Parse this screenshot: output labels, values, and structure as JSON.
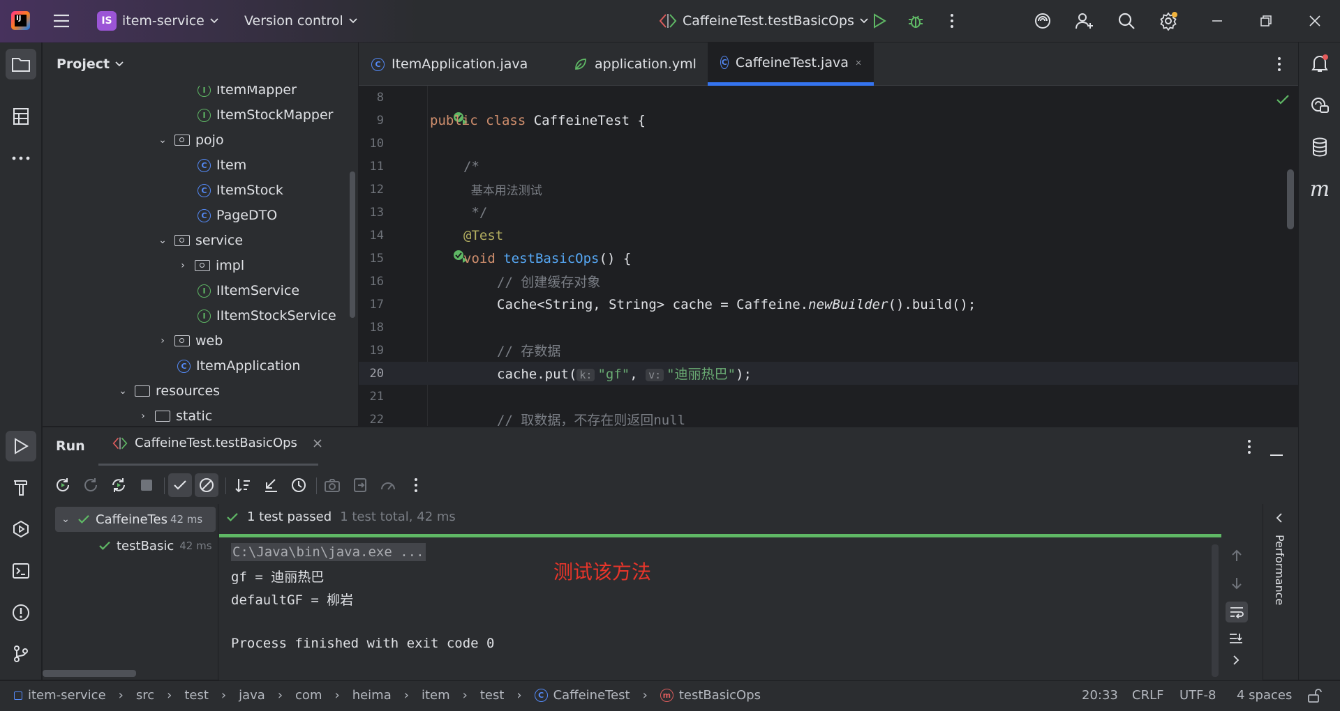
{
  "titlebar": {
    "project_badge": "IS",
    "project_name": "item-service",
    "vcs_label": "Version control",
    "run_config": "CaffeineTest.testBasicOps"
  },
  "project_panel": {
    "title": "Project",
    "tree": [
      {
        "label": "ItemMapper",
        "kind": "interface"
      },
      {
        "label": "ItemStockMapper",
        "kind": "interface"
      },
      {
        "label": "pojo",
        "kind": "package"
      },
      {
        "label": "Item",
        "kind": "class"
      },
      {
        "label": "ItemStock",
        "kind": "class"
      },
      {
        "label": "PageDTO",
        "kind": "class"
      },
      {
        "label": "service",
        "kind": "package"
      },
      {
        "label": "impl",
        "kind": "package"
      },
      {
        "label": "IItemService",
        "kind": "interface"
      },
      {
        "label": "IItemStockService",
        "kind": "interface"
      },
      {
        "label": "web",
        "kind": "package"
      },
      {
        "label": "ItemApplication",
        "kind": "class"
      },
      {
        "label": "resources",
        "kind": "folder"
      },
      {
        "label": "static",
        "kind": "folder"
      }
    ]
  },
  "editor": {
    "tabs": [
      {
        "label": "ItemApplication.java"
      },
      {
        "label": "application.yml"
      },
      {
        "label": "CaffeineTest.java"
      }
    ],
    "line_numbers": [
      "8",
      "9",
      "10",
      "11",
      "12",
      "13",
      "14",
      "15",
      "16",
      "17",
      "18",
      "19",
      "20",
      "21",
      "22"
    ],
    "code": {
      "l9_kw1": "public",
      "l9_kw2": "class",
      "l9_rest": " CaffeineTest {",
      "l11": "/*",
      "l12": "  基本用法测试",
      "l13": " */",
      "l14": "@Test",
      "l15_kw": "void",
      "l15_fn": "testBasicOps",
      "l15_rest": "() {",
      "l16": "// 创建缓存对象",
      "l17_a": "Cache<String, String> cache = Caffeine.",
      "l17_b": "newBuilder",
      "l17_c": "().build();",
      "l19": "// 存数据",
      "l20_a": "cache.put(",
      "l20_hint1": "k:",
      "l20_s1": "\"gf\"",
      "l20_comma": ", ",
      "l20_hint2": "v:",
      "l20_s2": "\"迪丽热巴\"",
      "l20_end": ");",
      "l22": "// 取数据，不存在则返回null"
    }
  },
  "run_panel": {
    "title": "Run",
    "tab_label": "CaffeineTest.testBasicOps",
    "test_tree": [
      {
        "label": "CaffeineTes",
        "time": "42 ms"
      },
      {
        "label": "testBasic",
        "time": "42 ms"
      }
    ],
    "status_passed": "1 test passed",
    "status_total": "1 test total, 42 ms",
    "console_lines": [
      "C:\\Java\\bin\\java.exe ...",
      "gf = 迪丽热巴",
      "defaultGF = 柳岩",
      "",
      "Process finished with exit code 0"
    ],
    "annotation": "测试该方法",
    "side_label": "Performance"
  },
  "statusbar": {
    "breadcrumbs": [
      "item-service",
      "src",
      "test",
      "java",
      "com",
      "heima",
      "item",
      "test",
      "CaffeineTest",
      "testBasicOps"
    ],
    "position": "20:33",
    "line_sep": "CRLF",
    "encoding": "UTF-8",
    "indent": "4 spaces"
  },
  "colors": {
    "accent": "#3574f0",
    "success": "#5fb865",
    "annotation": "#e8352a",
    "badge": "#9b55d6"
  }
}
